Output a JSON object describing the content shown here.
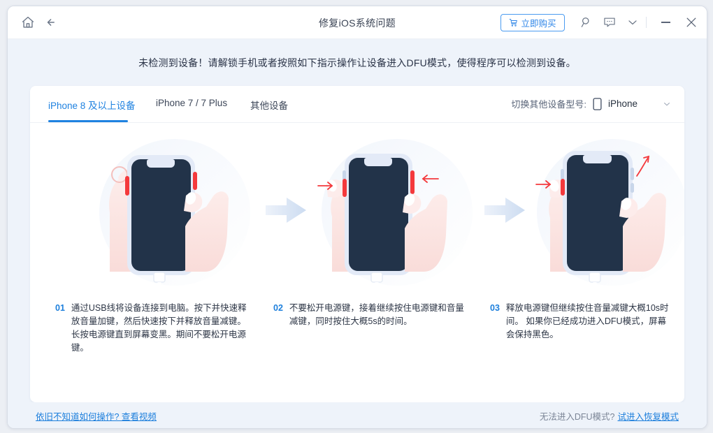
{
  "window": {
    "title": "修复iOS系统问题",
    "home_icon": "home-icon",
    "back_icon": "back-arrow-icon",
    "buy_label": "立即购买",
    "cart_icon": "cart-icon",
    "search_icon": "search-icon",
    "feedback_icon": "feedback-icon",
    "chevron_icon": "chevron-down-icon",
    "minimize_icon": "minimize-icon",
    "close_icon": "close-icon",
    "accent": "#1f82e0",
    "banner_bg": "#eef3fa"
  },
  "banner": {
    "message": "未检测到设备！请解锁手机或者按照如下指示操作让设备进入DFU模式，使得程序可以检测到设备。"
  },
  "tabs": [
    {
      "label": "iPhone 8 及以上设备",
      "active": true
    },
    {
      "label": "iPhone 7 / 7 Plus",
      "active": false
    },
    {
      "label": "其他设备",
      "active": false
    }
  ],
  "device_switch": {
    "label": "切换其他设备型号:",
    "value": "iPhone",
    "icon": "phone-icon",
    "chevron": "chevron-down-icon"
  },
  "steps": [
    {
      "num": "01",
      "text": "通过USB线将设备连接到电脑。按下并快速释放音量加键，然后快速按下并释放音量减键。长按电源键直到屏幕变黑。期间不要松开电源键。"
    },
    {
      "num": "02",
      "text": "不要松开电源键，接着继续按住电源键和音量减键，同时按住大概5s的时间。"
    },
    {
      "num": "03",
      "text": "释放电源键但继续按住音量减键大概10s时间。 如果你已经成功进入DFU模式，屏幕会保持黑色。"
    }
  ],
  "illustrations": [
    {
      "alt": "hands-holding-iphone-press-volume"
    },
    {
      "alt": "hands-holding-iphone-press-power-and-volume-down"
    },
    {
      "alt": "hands-holding-iphone-release-power-hold-volume-down"
    }
  ],
  "footer": {
    "help_link": "依旧不知道如何操作? 查看视频",
    "dfu_question": "无法进入DFU模式?",
    "recovery_link": "试进入恢复模式"
  }
}
